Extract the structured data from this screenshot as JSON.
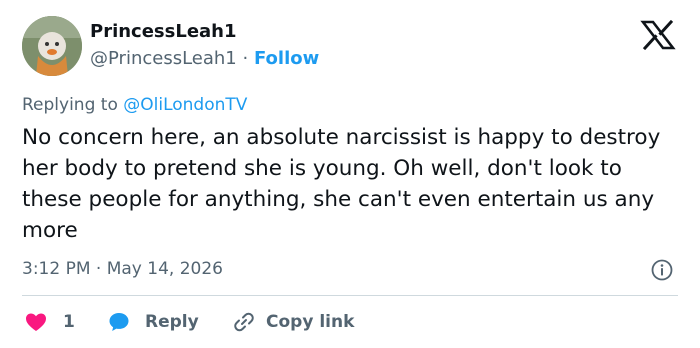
{
  "author": {
    "display_name": "PrincessLeah1",
    "handle": "@PrincessLeah1",
    "separator": "·",
    "follow_label": "Follow"
  },
  "platform_logo": "x-logo-icon",
  "reply_context": {
    "prefix": "Replying to ",
    "target": "@OliLondonTV"
  },
  "tweet": {
    "text": "No concern here, an absolute narcissist is happy to destroy her body to pretend she is young. Oh well, don't look to these people for anything, she can't even entertain us any more",
    "timestamp": "3:12 PM · May 14, 2026"
  },
  "actions": {
    "like_count": "1",
    "reply_label": "Reply",
    "copy_label": "Copy link"
  },
  "colors": {
    "accent": "#1d9bf0",
    "text": "#0f1419",
    "muted": "#536471",
    "like": "#f91880",
    "divider": "#cfd9de"
  },
  "icons": [
    "avatar-image",
    "x-logo-icon",
    "info-icon",
    "heart-icon",
    "speech-bubble-icon",
    "link-icon"
  ]
}
